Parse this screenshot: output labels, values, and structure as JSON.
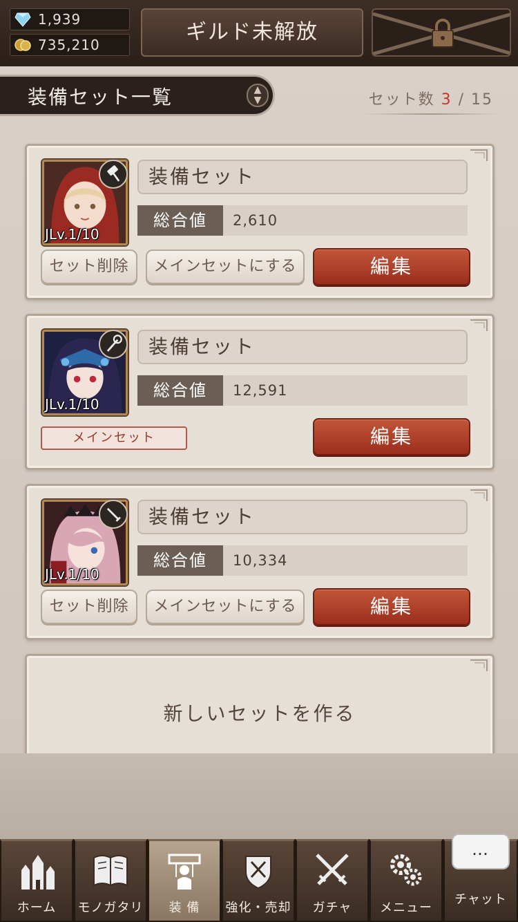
{
  "header": {
    "gems": "1,939",
    "gold": "735,210",
    "guild_button": "ギルド未解放"
  },
  "page": {
    "title": "装備セット一覧",
    "set_count_label": "セット数",
    "set_count_current": "3",
    "set_count_separator": "/",
    "set_count_max": "15"
  },
  "sets": [
    {
      "name": "装備セット",
      "total_label": "総合値",
      "total": "2,610",
      "level": "JLv.1/10",
      "weapon_icon": "hammer-icon",
      "delete_label": "セット削除",
      "make_main_label": "メインセットにする",
      "edit_label": "編集"
    },
    {
      "name": "装備セット",
      "total_label": "総合値",
      "total": "12,591",
      "level": "JLv.1/10",
      "weapon_icon": "staff-icon",
      "main_tag": "メインセット",
      "edit_label": "編集"
    },
    {
      "name": "装備セット",
      "total_label": "総合値",
      "total": "10,334",
      "level": "JLv.1/10",
      "weapon_icon": "sword-icon",
      "delete_label": "セット削除",
      "make_main_label": "メインセットにする",
      "edit_label": "編集"
    }
  ],
  "new_set_label": "新しいセットを作る",
  "nav": [
    {
      "label": "ホーム",
      "icon": "castle-icon"
    },
    {
      "label": "モノガタリ",
      "icon": "book-icon"
    },
    {
      "label": "装 備",
      "icon": "equipment-icon",
      "active": true
    },
    {
      "label": "強化・売却",
      "icon": "shield-icon"
    },
    {
      "label": "ガチャ",
      "icon": "crossed-swords-icon"
    },
    {
      "label": "メニュー",
      "icon": "gears-icon"
    },
    {
      "label": "チャット",
      "icon": "chat-icon"
    }
  ],
  "chat_bubble": "…",
  "colors": {
    "accent_red": "#c0392b",
    "edit_button": "#b04228",
    "dark_header": "#2b211c"
  }
}
